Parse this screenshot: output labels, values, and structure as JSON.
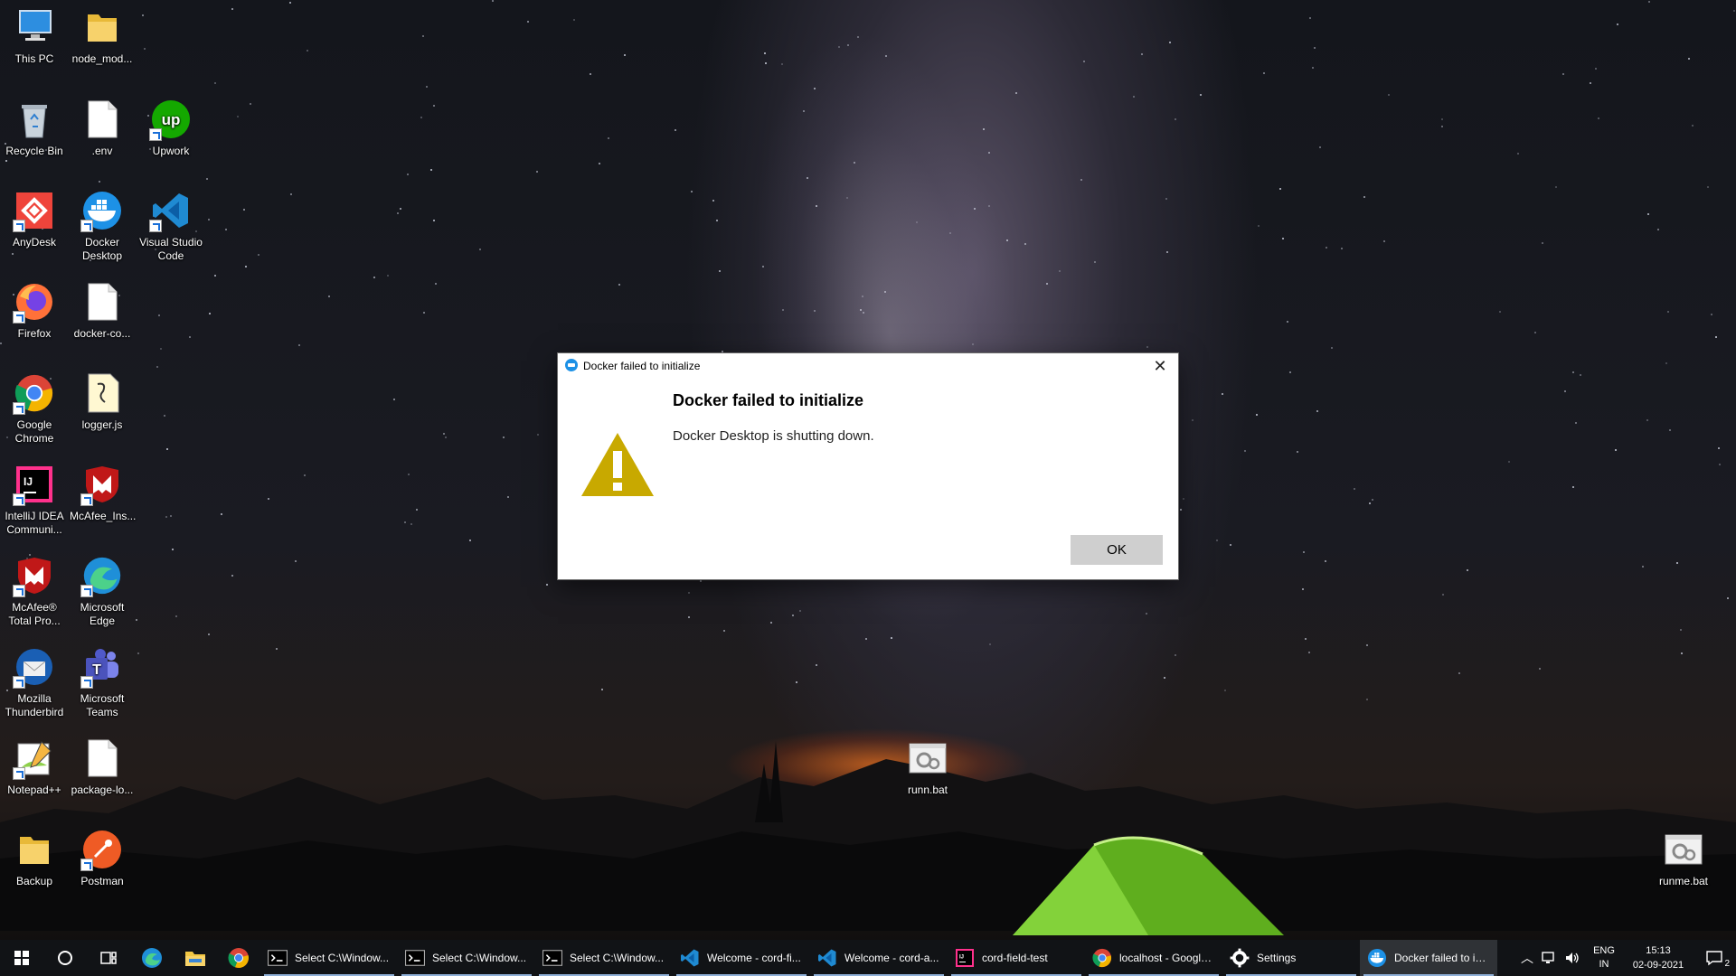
{
  "desktop": {
    "icons": [
      {
        "label": "This PC",
        "icon": "computer-icon"
      },
      {
        "label": "node_mod...",
        "icon": "folder-icon"
      },
      {
        "label": "Recycle Bin",
        "icon": "recycle-bin-icon"
      },
      {
        "label": ".env",
        "icon": "file-icon"
      },
      {
        "label": "Upwork",
        "icon": "upwork-icon"
      },
      {
        "label": "AnyDesk",
        "icon": "anydesk-icon"
      },
      {
        "label": "Docker Desktop",
        "icon": "docker-icon"
      },
      {
        "label": "Visual Studio Code",
        "icon": "vscode-icon"
      },
      {
        "label": "Firefox",
        "icon": "firefox-icon"
      },
      {
        "label": "docker-co...",
        "icon": "file-icon"
      },
      {
        "label": "Google Chrome",
        "icon": "chrome-icon"
      },
      {
        "label": "logger.js",
        "icon": "js-file-icon"
      },
      {
        "label": "IntelliJ IDEA Communi...",
        "icon": "intellij-icon"
      },
      {
        "label": "McAfee_Ins...",
        "icon": "mcafee-icon"
      },
      {
        "label": "McAfee® Total Pro...",
        "icon": "mcafee-icon"
      },
      {
        "label": "Microsoft Edge",
        "icon": "edge-icon"
      },
      {
        "label": "Mozilla Thunderbird",
        "icon": "thunderbird-icon"
      },
      {
        "label": "Microsoft Teams",
        "icon": "teams-icon"
      },
      {
        "label": "Notepad++",
        "icon": "notepadpp-icon"
      },
      {
        "label": "package-lo...",
        "icon": "file-icon"
      },
      {
        "label": "Backup",
        "icon": "folder-icon"
      },
      {
        "label": "Postman",
        "icon": "postman-icon"
      },
      {
        "label": "runn.bat",
        "icon": "batch-file-icon"
      },
      {
        "label": "runme.bat",
        "icon": "batch-file-icon"
      }
    ]
  },
  "dialog": {
    "window_title": "Docker failed to initialize",
    "heading": "Docker failed to initialize",
    "message": "Docker Desktop is shutting down.",
    "ok_label": "OK",
    "close_glyph": "✕",
    "warning_color": "#c8a900"
  },
  "taskbar": {
    "tasks": [
      {
        "label": "Select C:\\Window...",
        "icon": "terminal-icon"
      },
      {
        "label": "Select C:\\Window...",
        "icon": "terminal-icon"
      },
      {
        "label": "Select C:\\Window...",
        "icon": "terminal-icon"
      },
      {
        "label": "Welcome - cord-fi...",
        "icon": "vscode-icon"
      },
      {
        "label": "Welcome - cord-a...",
        "icon": "vscode-icon"
      },
      {
        "label": "cord-field-test",
        "icon": "intellij-icon"
      },
      {
        "label": "localhost - Google...",
        "icon": "chrome-icon"
      },
      {
        "label": "Settings",
        "icon": "gear-icon"
      },
      {
        "label": "Docker failed to in...",
        "icon": "docker-icon"
      }
    ],
    "lang_line1": "ENG",
    "lang_line2": "IN",
    "time": "15:13",
    "date": "02-09-2021",
    "notification_count": "2"
  }
}
